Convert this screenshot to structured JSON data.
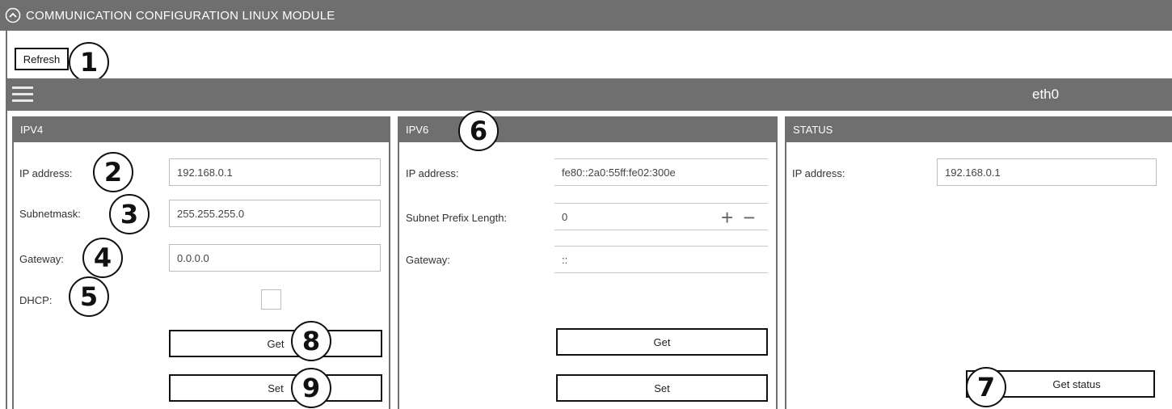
{
  "window": {
    "title": "COMMUNICATION CONFIGURATION LINUX MODULE"
  },
  "toolbar": {
    "refresh_label": "Refresh"
  },
  "interface": {
    "name": "eth0"
  },
  "ipv4": {
    "header": "IPV4",
    "ip_label": "IP address:",
    "ip_value": "192.168.0.1",
    "subnet_label": "Subnetmask:",
    "subnet_value": "255.255.255.0",
    "gateway_label": "Gateway:",
    "gateway_value": "0.0.0.0",
    "dhcp_label": "DHCP:",
    "dhcp_checked": false,
    "get_label": "Get",
    "set_label": "Set"
  },
  "ipv6": {
    "header": "IPV6",
    "ip_label": "IP address:",
    "ip_value": "fe80::2a0:55ff:fe02:300e",
    "prefix_label": "Subnet Prefix Length:",
    "prefix_value": "0",
    "stepper_plus": "+",
    "stepper_minus": "−",
    "gateway_label": "Gateway:",
    "gateway_value": "::",
    "get_label": "Get",
    "set_label": "Set"
  },
  "status": {
    "header": "STATUS",
    "ip_label": "IP address:",
    "ip_value": "192.168.0.1",
    "get_status_label": "Get status"
  },
  "callouts": [
    "1",
    "2",
    "3",
    "4",
    "5",
    "6",
    "7",
    "8",
    "9"
  ]
}
